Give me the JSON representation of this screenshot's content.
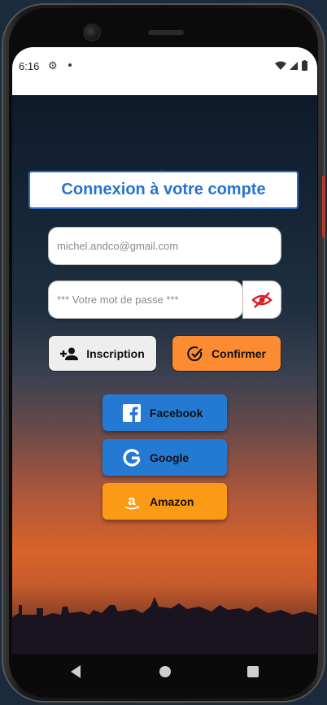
{
  "status": {
    "time": "6:16"
  },
  "title": "Connexion à votre compte",
  "email": {
    "value": "",
    "placeholder": "michel.andco@gmail.com"
  },
  "password": {
    "value": "",
    "placeholder": "*** Votre mot de passe ***",
    "toggle_icon": "eye-off-icon",
    "toggle_color": "#d81b24"
  },
  "buttons": {
    "inscription": "Inscription",
    "confirmer": "Confirmer"
  },
  "social": [
    {
      "label": "Facebook",
      "icon": "facebook-icon",
      "color": "#2479d3"
    },
    {
      "label": "Google",
      "icon": "google-icon",
      "color": "#2479d3"
    },
    {
      "label": "Amazon",
      "icon": "amazon-icon",
      "color": "#fb9a14"
    }
  ],
  "colors": {
    "accent": "#2474d2",
    "confirm": "#fb8c32"
  }
}
